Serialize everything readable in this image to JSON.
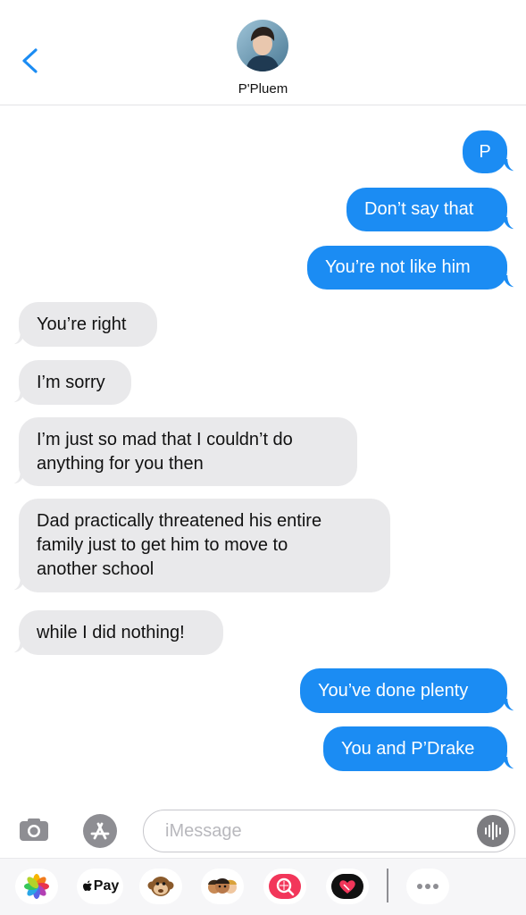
{
  "header": {
    "contact_name": "P'Pluem",
    "back_icon": "chevron-left-icon"
  },
  "messages": [
    {
      "from": "me",
      "text": "P"
    },
    {
      "from": "me",
      "text": "Don’t say that"
    },
    {
      "from": "me",
      "text": "You’re not like him"
    },
    {
      "from": "them",
      "text": "You’re right"
    },
    {
      "from": "them",
      "text": "I’m sorry"
    },
    {
      "from": "them",
      "text": "I’m just so mad that I couldn’t do\nanything for you then"
    },
    {
      "from": "them",
      "text": "Dad practically threatened his entire\nfamily just to get him to move to\nanother school"
    },
    {
      "from": "them",
      "text": "while I did nothing!"
    },
    {
      "from": "me",
      "text": "You’ve done plenty"
    },
    {
      "from": "me",
      "text": "You and P’Drake"
    }
  ],
  "compose": {
    "placeholder": "iMessage"
  },
  "app_drawer": {
    "apple_pay_label": "Pay",
    "apps": [
      "photos-app-icon",
      "apple-pay-icon",
      "animoji-icon",
      "memoji-icon",
      "image-search-icon",
      "digital-touch-icon",
      "more-icon"
    ]
  },
  "colors": {
    "outgoing": "#1b8cf3",
    "incoming": "#e9e9eb",
    "accent": "#1b8cf3"
  }
}
